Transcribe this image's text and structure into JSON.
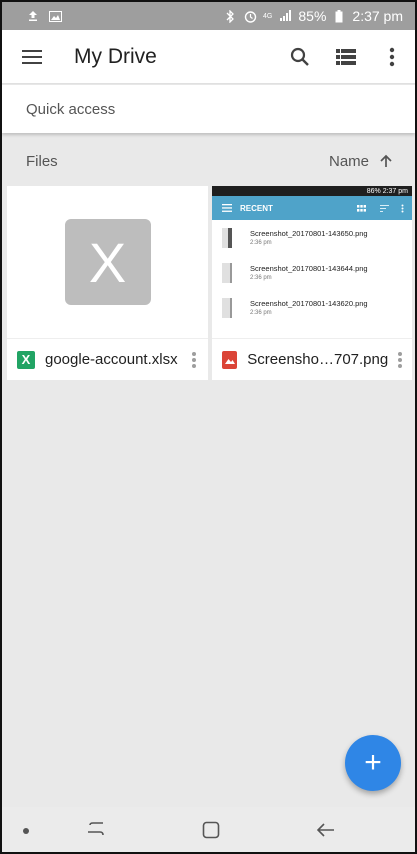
{
  "status_bar": {
    "battery": "85%",
    "time": "2:37 pm",
    "network": "4G"
  },
  "app_bar": {
    "title": "My Drive",
    "icons": [
      "menu-icon",
      "search-icon",
      "list-view-icon",
      "more-vert-icon"
    ]
  },
  "quick_access": {
    "label": "Quick access"
  },
  "files_header": {
    "label": "Files",
    "sort_label": "Name"
  },
  "files": [
    {
      "name": "google-account.xlsx",
      "type_glyph": "X",
      "type_color": "#21a464",
      "thumb_glyph": "X"
    },
    {
      "name": "Screensho…707.png",
      "type_color": "#db4437"
    }
  ],
  "preview": {
    "status_text": "86% 2:37 pm",
    "bar_title": "RECENT",
    "rows": [
      {
        "name": "Screenshot_20170801-143650.png",
        "time": "2:36 pm"
      },
      {
        "name": "Screenshot_20170801-143644.png",
        "time": "2:36 pm"
      },
      {
        "name": "Screenshot_20170801-143620.png",
        "time": "2:36 pm"
      }
    ]
  },
  "fab": {
    "glyph": "+"
  },
  "colors": {
    "accent": "#2f86e6",
    "status_bar": "#9e9e9e",
    "preview_bar": "#4fa3c9"
  }
}
